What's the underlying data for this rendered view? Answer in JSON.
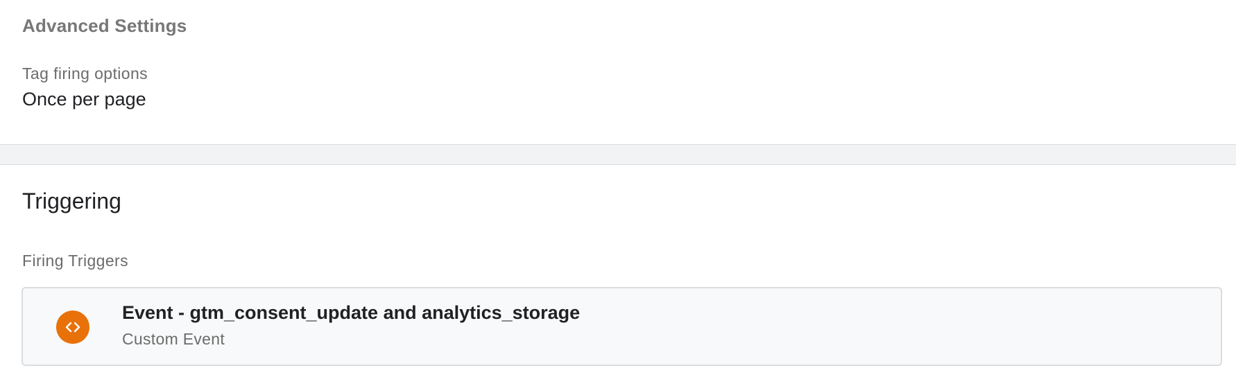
{
  "advanced_settings": {
    "title": "Advanced Settings",
    "tag_firing_options_label": "Tag firing options",
    "tag_firing_options_value": "Once per page"
  },
  "triggering": {
    "title": "Triggering",
    "firing_triggers_label": "Firing Triggers",
    "triggers": [
      {
        "name": "Event - gtm_consent_update and analytics_storage",
        "type": "Custom Event",
        "icon": "code-brackets-icon",
        "icon_color": "#e8710a"
      }
    ]
  }
}
